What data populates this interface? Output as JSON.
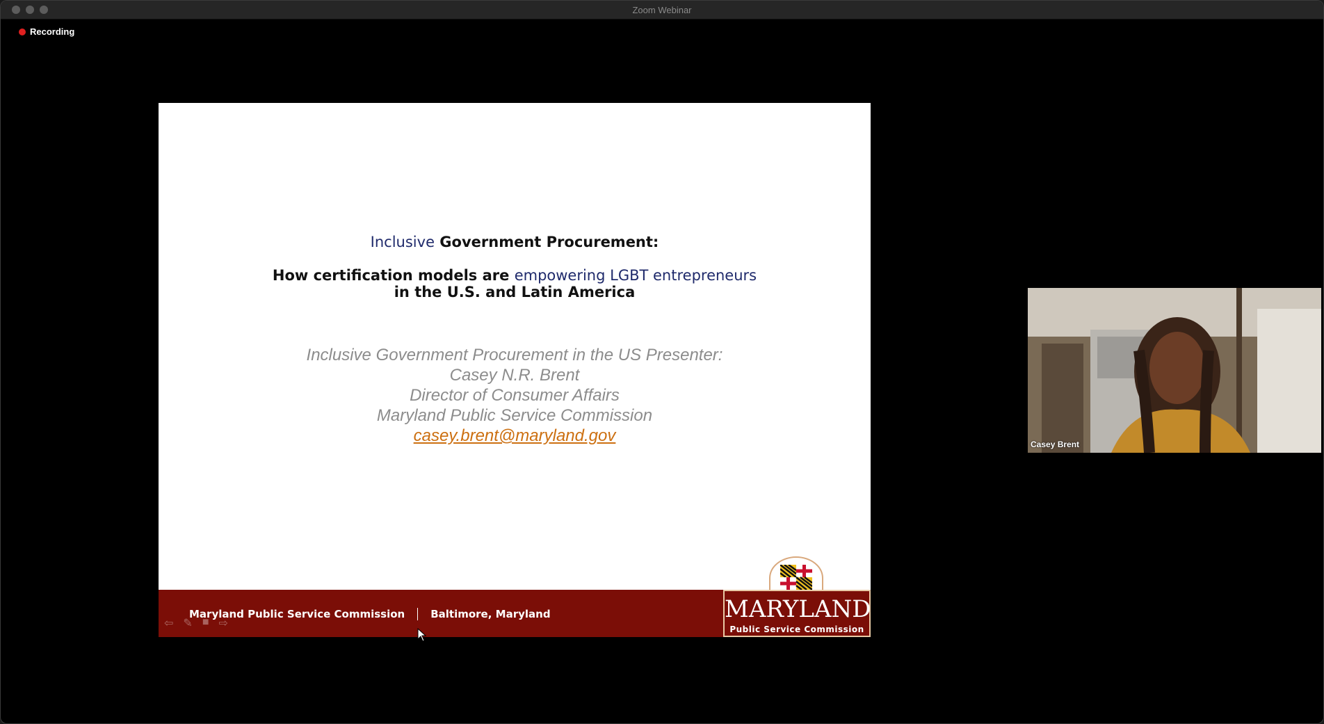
{
  "window": {
    "title": "Zoom Webinar",
    "recording_label": "Recording"
  },
  "slide": {
    "title_highlight": "Inclusive",
    "title_rest": " Government Procurement:",
    "subtitle_part1": "How certification models are ",
    "subtitle_highlight1": "empowering",
    "subtitle_highlight2": " LGBT ",
    "subtitle_highlight3": "entrepreneurs",
    "subtitle_part2": " in the U.S. and Latin America",
    "presenter_line1": "Inclusive Government Procurement in the US Presenter:",
    "presenter_name": "Casey N.R. Brent",
    "presenter_role": "Director of Consumer Affairs",
    "presenter_org": "Maryland Public Service Commission",
    "presenter_email": "casey.brent@maryland.gov",
    "footer_left": "Maryland Public Service Commission",
    "footer_right": "Baltimore, Maryland",
    "logo_word": "MARYLAND",
    "logo_sub": "Public Service Commission"
  },
  "participant": {
    "name": "Casey Brent"
  },
  "colors": {
    "accent_blue": "#1f2a6b",
    "footer_red": "#7b0e07",
    "email_orange": "#cc6f10",
    "recording_red": "#e02020"
  }
}
